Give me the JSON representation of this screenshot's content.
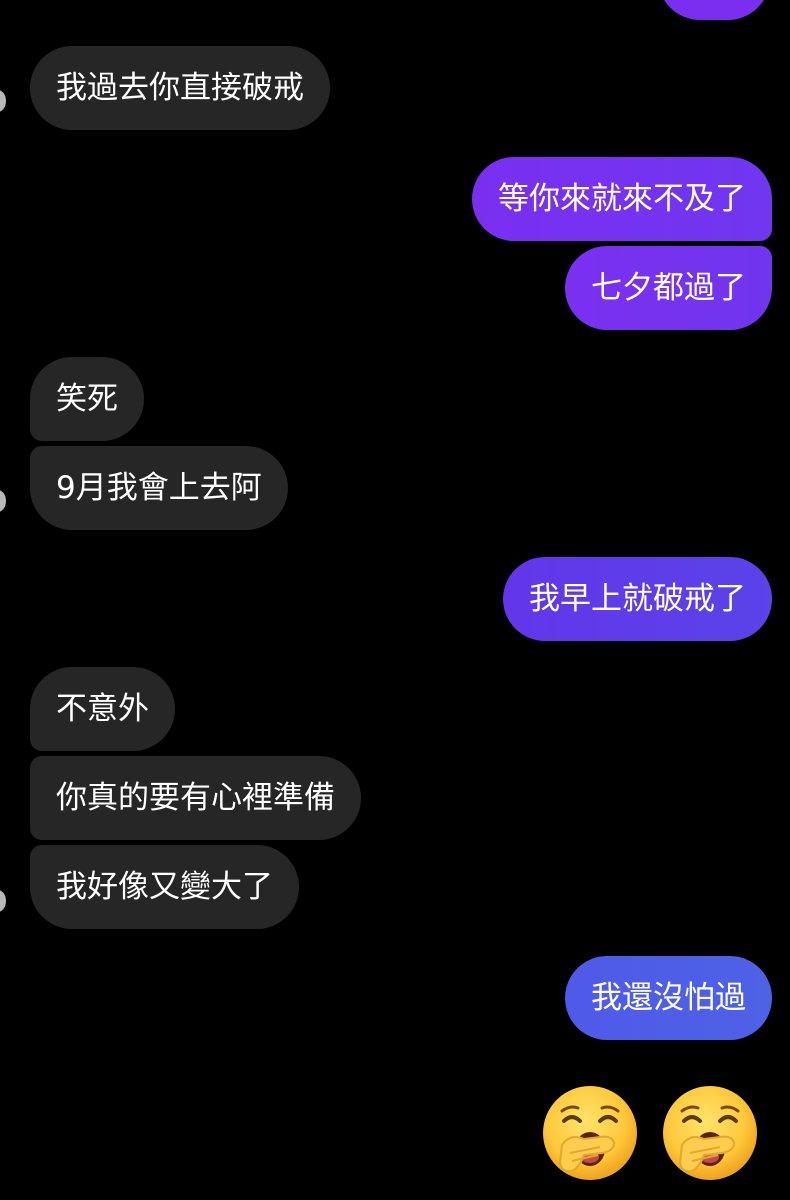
{
  "messages": [
    {
      "side": "in",
      "text": "我過去你直接破戒"
    },
    {
      "side": "out",
      "text": "等你來就來不及了"
    },
    {
      "side": "out",
      "text": "七夕都過了"
    },
    {
      "side": "in",
      "text": "笑死"
    },
    {
      "side": "in",
      "text": "9月我會上去阿"
    },
    {
      "side": "out",
      "text": "我早上就破戒了"
    },
    {
      "side": "in",
      "text": "不意外"
    },
    {
      "side": "in",
      "text": "你真的要有心裡準備"
    },
    {
      "side": "in",
      "text": "我好像又變大了"
    },
    {
      "side": "out",
      "text": "我還沒怕過"
    }
  ],
  "reaction_emojis": [
    "yawning-face",
    "yawning-face"
  ],
  "colors": {
    "background": "#000000",
    "incoming_bubble": "#262626",
    "outgoing_purple": "#7a2ff0",
    "outgoing_violet": "#5b40e8",
    "outgoing_blue": "#4f5de8",
    "text": "#ffffff"
  }
}
